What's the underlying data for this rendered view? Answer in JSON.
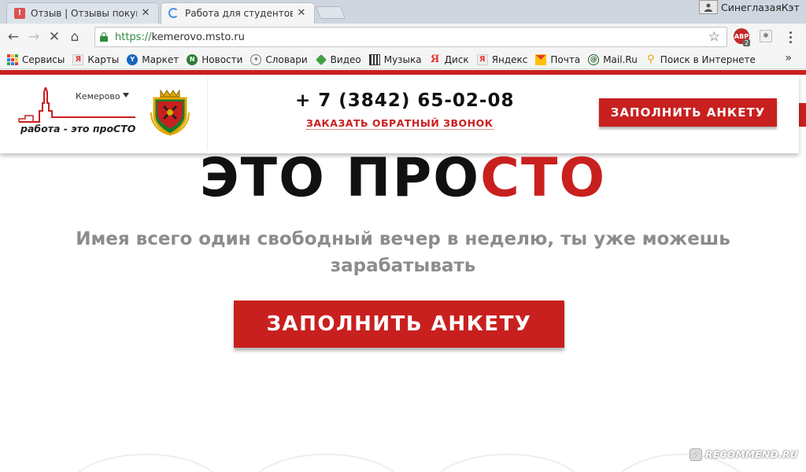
{
  "browser": {
    "tabs": [
      {
        "title": "Отзыв | Отзывы покупат",
        "favicon": "otzyv-icon",
        "favicon_text": "!",
        "active": false
      },
      {
        "title": "Работа для студентов, п",
        "favicon": "loading-spinner-icon",
        "active": true
      }
    ],
    "close_glyph": "✕",
    "profile_name": "СинеглазаяКэт",
    "url": {
      "scheme": "https://",
      "host": "kemerovo.msto.ru"
    },
    "nav": {
      "back": "←",
      "forward": "→",
      "stop": "✕",
      "home": "⌂"
    },
    "star_glyph": "☆",
    "extensions": [
      {
        "name": "adblock-icon",
        "text": "ABP",
        "badge": "2"
      },
      {
        "name": "extension-icon",
        "text": "✱"
      }
    ],
    "bookmarks": [
      {
        "label": "Сервисы",
        "icon": "apps-grid-icon"
      },
      {
        "label": "Карты",
        "icon": "yandex-icon"
      },
      {
        "label": "Маркет",
        "icon": "market-icon"
      },
      {
        "label": "Новости",
        "icon": "news-icon"
      },
      {
        "label": "Словари",
        "icon": "dictionary-icon"
      },
      {
        "label": "Видео",
        "icon": "video-icon"
      },
      {
        "label": "Музыка",
        "icon": "music-icon"
      },
      {
        "label": "Диск",
        "icon": "yandex-disk-icon"
      },
      {
        "label": "Яндекс",
        "icon": "yandex-icon"
      },
      {
        "label": "Почта",
        "icon": "mail-icon"
      },
      {
        "label": "Mail.Ru",
        "icon": "mailru-icon"
      },
      {
        "label": "Поиск в Интернете",
        "icon": "search-icon"
      }
    ],
    "bookmarks_more": "»"
  },
  "site": {
    "city": "Кемерово",
    "logo": {
      "text_main": "работа - это про",
      "text_accent": "СТО"
    },
    "phone": "+ 7 (3842) 65-02-08",
    "callback_label": "ЗАКАЗАТЬ ОБРАТНЫЙ ЗВОНОК",
    "header_button": "ЗАПОЛНИТЬ АНКЕТУ",
    "hero": {
      "title_main": "ЭТО ПРО",
      "title_accent": "СТО",
      "subtitle": "Имея всего один свободный вечер в неделю, ты уже можешь зарабатывать",
      "cta": "ЗАПОЛНИТЬ АНКЕТУ"
    },
    "colors": {
      "brand_red": "#c8201f",
      "subtitle_gray": "#8c8c8c"
    }
  },
  "watermark": {
    "text": "RECOMMEND.RU"
  }
}
